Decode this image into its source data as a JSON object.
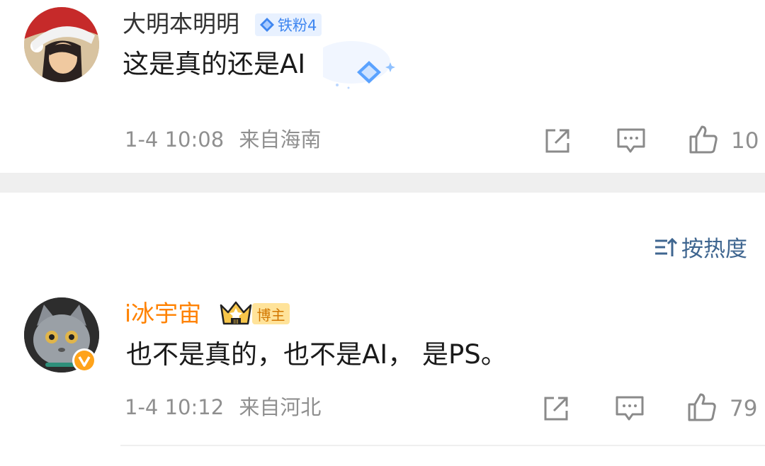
{
  "comments": [
    {
      "username": "大明本明明",
      "fan_badge": "铁粉4",
      "text": "这是真的还是AI",
      "timestamp": "1-4 10:08",
      "location": "来自海南",
      "likes": "10"
    },
    {
      "username": "i冰宇宙",
      "host_badge": "博主",
      "crown_level": "III",
      "text": "也不是真的，也不是AI， 是PS。",
      "timestamp": "1-4 10:12",
      "location": "来自河北",
      "likes": "79"
    }
  ],
  "sort": {
    "label": "按热度"
  },
  "icons": [
    "avatar",
    "diamond-icon",
    "share-icon",
    "comment-icon",
    "like-icon",
    "sort-icon",
    "crown-icon",
    "verified-icon"
  ],
  "colors": {
    "username_dark": "#333333",
    "username_orange": "#ff8200",
    "meta": "#8f8f8f",
    "sort_blue": "#3f6690",
    "fan_badge": "#3f86f0"
  }
}
